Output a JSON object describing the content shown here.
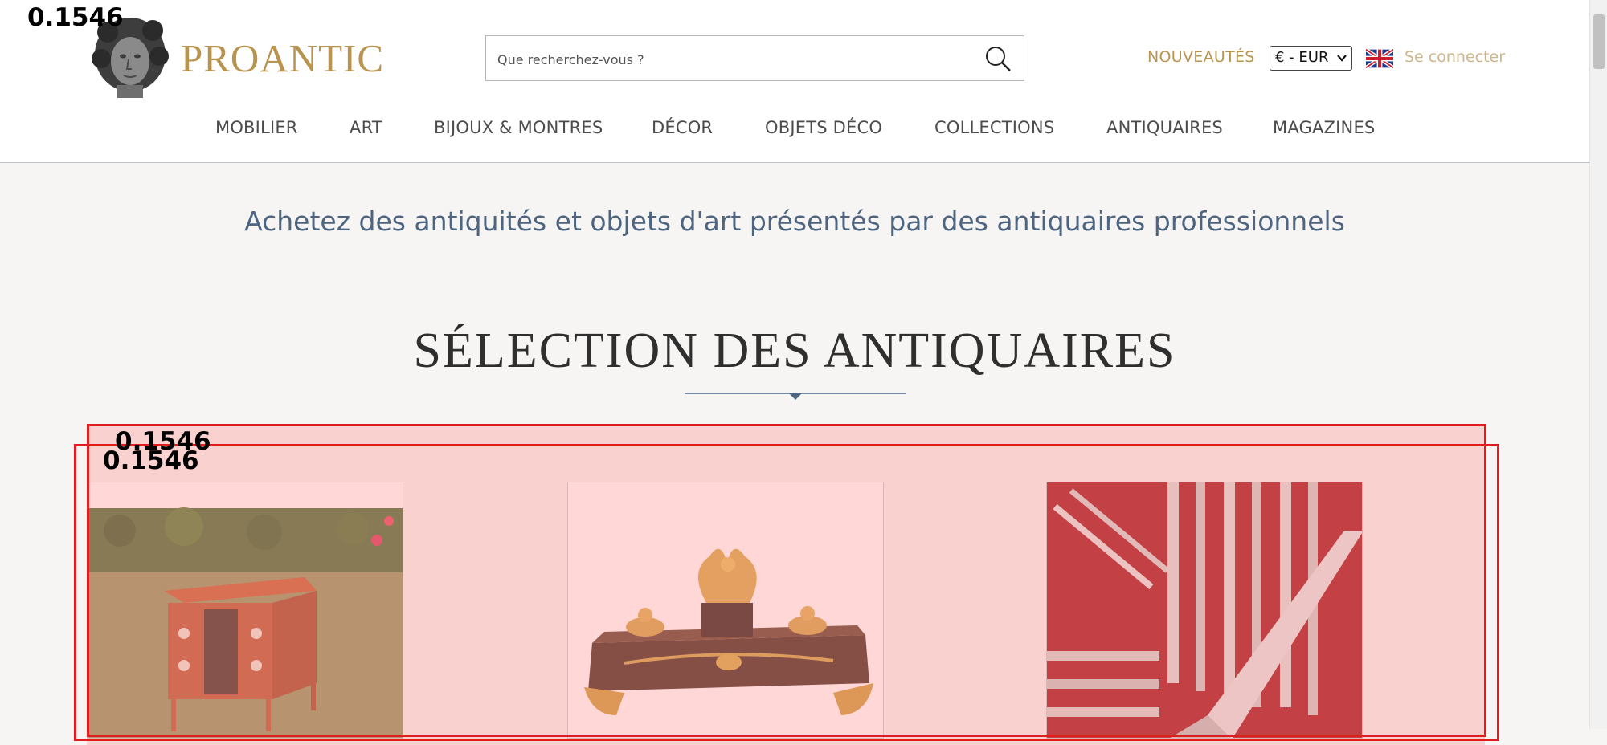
{
  "header": {
    "logo_text": "PROANTIC",
    "search_placeholder": "Que recherchez-vous ?",
    "nouveautes_label": "NOUVEAUTÉS",
    "currency_value": "€ - EUR",
    "login_label": "Se connecter",
    "brand_color": "#b8944f"
  },
  "nav": {
    "items": [
      {
        "label": "MOBILIER"
      },
      {
        "label": "ART"
      },
      {
        "label": "BIJOUX & MONTRES"
      },
      {
        "label": "DÉCOR"
      },
      {
        "label": "OBJETS DÉCO"
      },
      {
        "label": "COLLECTIONS"
      },
      {
        "label": "ANTIQUAIRES"
      },
      {
        "label": "MAGAZINES"
      }
    ]
  },
  "main": {
    "tagline": "Achetez des antiquités et objets d'art présentés par des antiquaires professionnels",
    "section_title": "SÉLECTION DES ANTIQUAIRES",
    "products": [
      {
        "icon": "commode-image"
      },
      {
        "icon": "encrier-image"
      },
      {
        "icon": "menagere-image"
      }
    ]
  },
  "overlays": {
    "score_top": "0.1546",
    "score_box1": "0.1546",
    "score_box2": "0.1546",
    "highlight_color": "#e11d22"
  }
}
